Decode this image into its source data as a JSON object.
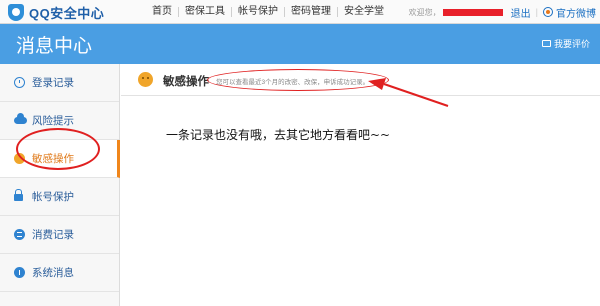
{
  "app": {
    "title": "QQ安全中心"
  },
  "nav": {
    "items": [
      {
        "label": "首页"
      },
      {
        "label": "密保工具"
      },
      {
        "label": "帐号保护"
      },
      {
        "label": "密码管理"
      },
      {
        "label": "安全学堂"
      }
    ]
  },
  "user": {
    "welcome": "欢迎您，",
    "logout": "退出",
    "separator": "|",
    "weibo": "官方微博"
  },
  "header": {
    "title": "消息中心",
    "feedback": "我要评价"
  },
  "sidebar": {
    "items": [
      {
        "label": "登录记录",
        "icon": "clock-icon"
      },
      {
        "label": "风险提示",
        "icon": "cloud-icon"
      },
      {
        "label": "敏感操作",
        "icon": "smile-icon",
        "active": true
      },
      {
        "label": "帐号保护",
        "icon": "lock-icon"
      },
      {
        "label": "消费记录",
        "icon": "bag-icon"
      },
      {
        "label": "系统消息",
        "icon": "info-icon"
      }
    ]
  },
  "main": {
    "title": "敏感操作",
    "description": "您可以查看最近3个月的改密、改保，申诉成功记录。",
    "empty_message": "一条记录也没有哦，去其它地方看看吧~~"
  },
  "colors": {
    "brand": "#4a9ee3",
    "active": "#f0861b",
    "annotation": "#e02020"
  }
}
